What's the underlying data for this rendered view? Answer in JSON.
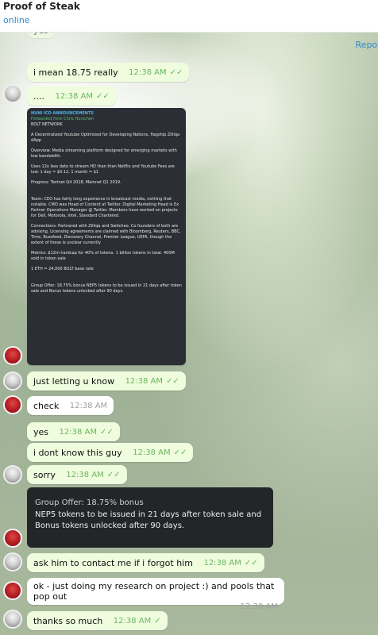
{
  "header": {
    "title": "Proof of Steak",
    "status": "online",
    "report_label": "Report"
  },
  "forwarded_card": {
    "title": "HUNI ICO ANNOUNCEMENTS",
    "forwarded": "Forwarded from Chris Hunichen",
    "name": "BOLT NETWORK",
    "lines": [
      "A Decentralized Youtube Optimized for Developing Nations, flagship Zilliqa dApp",
      "Overview: Media streaming platform designed for emerging markets with low bandwidth.",
      "Uses 12x less data to stream HD than than Netflix and Youtube Fees are low: 1 day = $0.12, 1 month = $1",
      "Progress: Testnet Q4 2018, Mainnet Q1 2019.",
      "Team: CEO has fairly long experience in broadcast media, nothing that notable. CMO was Head of Content at Twitter. Digital Marketing Head is Ex Partner Operations Manager @ Twitter. Members have worked on projects for Dell, Motorola, Intel, Standard Chartered.",
      "Connections: Partnered with Zilliqa and Switcheo. Co founders of both are advising. Licensing agreements are claimed with Bloomberg, Reuters, BBC, Time, Buzzfeed, Discovery Channel, Premier League, UEFA, though the extent of these is unclear currently",
      "Metrics: $12m hardcap for 40% of tokens. 1 billion tokens in total. 400M sold in token sale",
      "1 ETH = 24,000 BOLT base rate",
      "Group Offer: 18.75% bonus NEP5 tokens to be issued in 21 days after token sale and Bonus tokens unlocked after 90 days."
    ]
  },
  "quote": {
    "title": "Group Offer: 18.75% bonus",
    "body": "NEP5 tokens to be issued in 21 days after token sale and Bonus tokens unlocked after 90 days."
  },
  "messages": [
    {
      "text": "yes",
      "time": ""
    },
    {
      "text": "i mean 18.75 really",
      "time": "12:38 AM"
    },
    {
      "text": "....",
      "time": "12:38 AM"
    },
    {
      "text": "just letting u know",
      "time": "12:38 AM"
    },
    {
      "text": "check",
      "time": "12:38 AM"
    },
    {
      "text": "yes",
      "time": "12:38 AM"
    },
    {
      "text": "i dont know this guy",
      "time": "12:38 AM"
    },
    {
      "text": "sorry",
      "time": "12:38 AM"
    },
    {
      "text": "ask him to contact me if i forgot him",
      "time": "12:38 AM"
    },
    {
      "text": "ok - just doing my research on project :) and pools that pop out",
      "time": "12:38 AM"
    },
    {
      "text": "thanks so much",
      "time": "12:38 AM"
    }
  ],
  "colors": {
    "outgoing_bubble": "#effdde",
    "incoming_bubble": "#ffffff",
    "check": "#6cb55f",
    "link": "#2f8ad1"
  }
}
